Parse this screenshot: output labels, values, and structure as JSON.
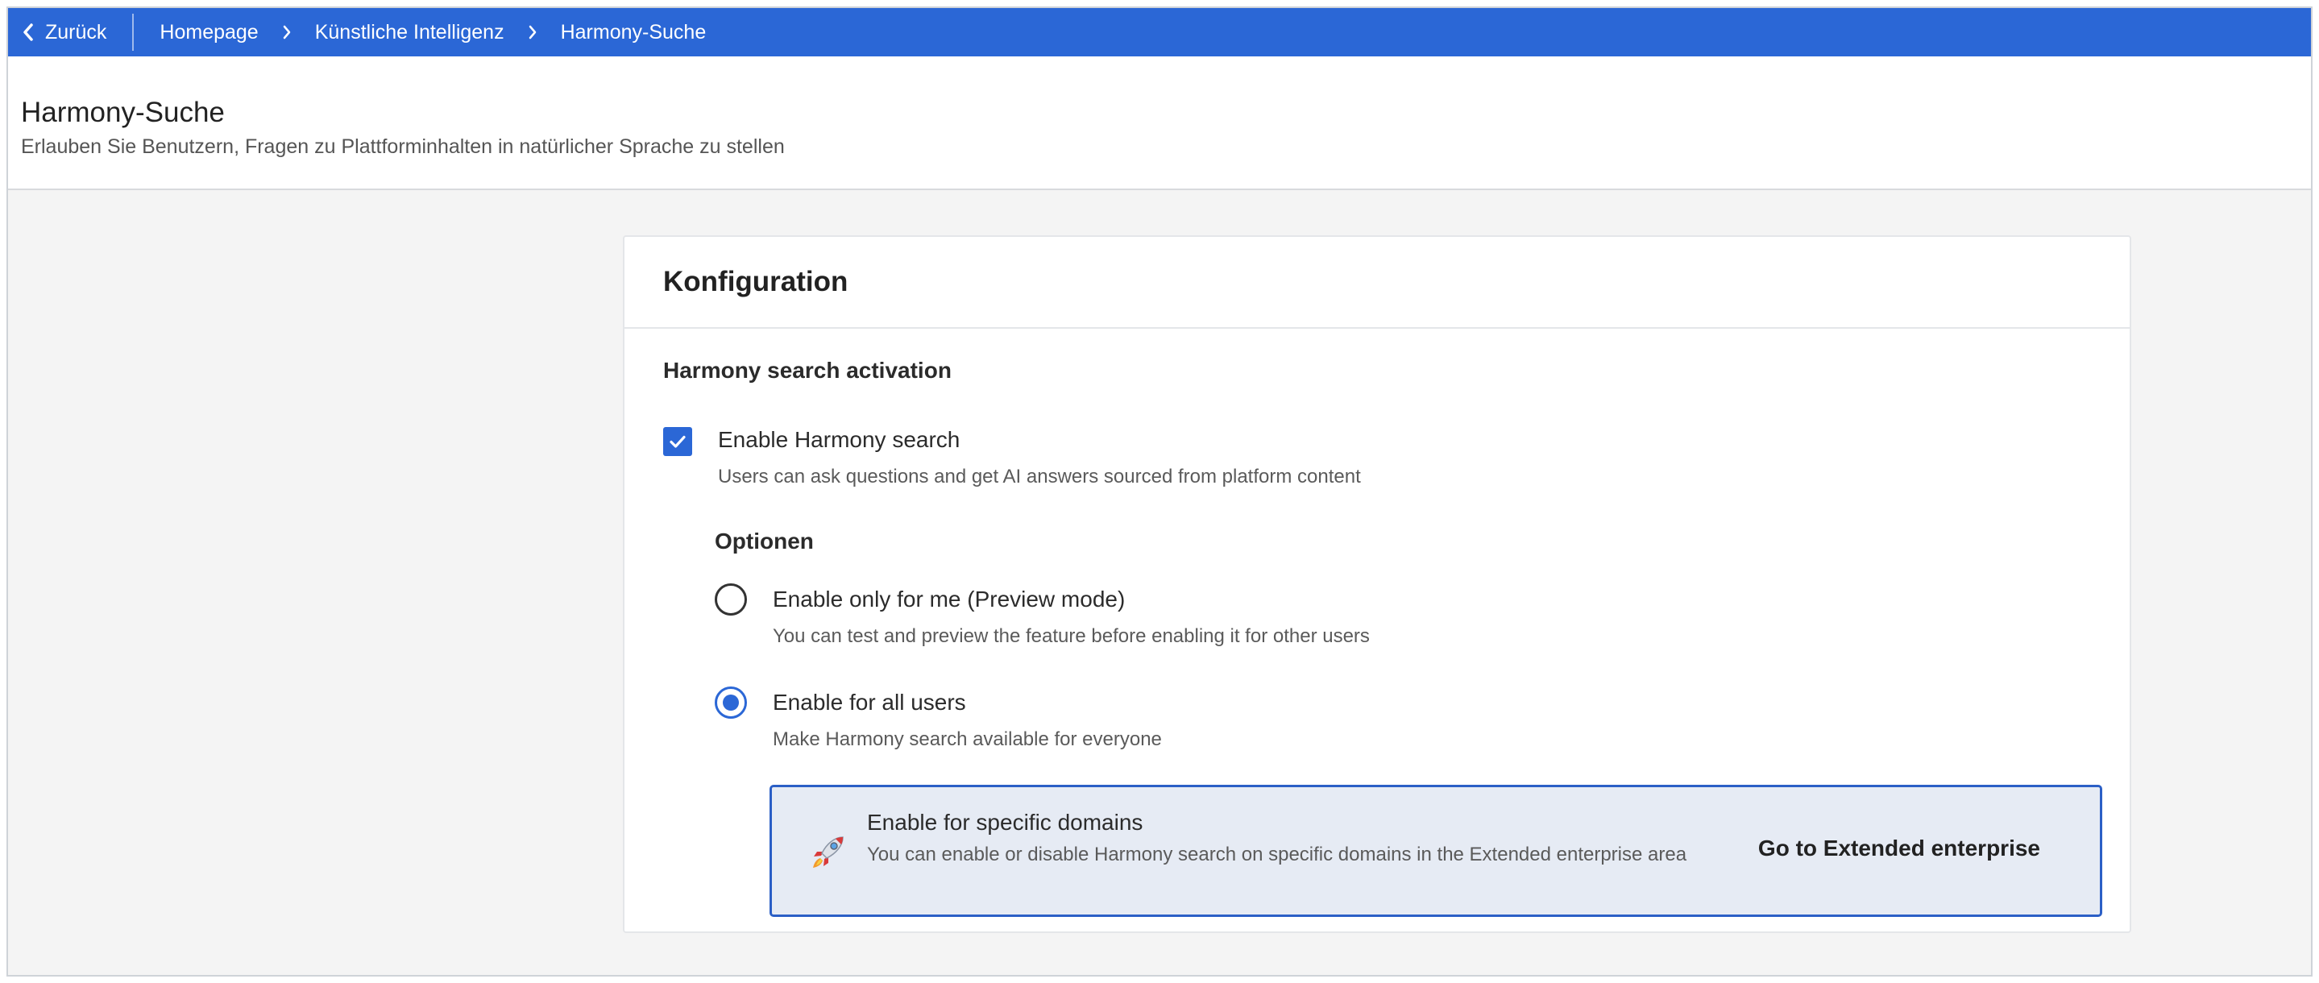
{
  "topbar": {
    "back_label": "Zurück",
    "breadcrumbs": [
      "Homepage",
      "Künstliche Intelligenz",
      "Harmony-Suche"
    ]
  },
  "header": {
    "title": "Harmony-Suche",
    "subtitle": "Erlauben Sie Benutzern, Fragen zu Plattforminhalten in natürlicher Sprache zu stellen"
  },
  "card": {
    "title": "Konfiguration",
    "section_title": "Harmony search activation",
    "enable": {
      "label": "Enable Harmony search",
      "description": "Users can ask questions and get AI answers sourced from platform content",
      "checked": true
    },
    "options_title": "Optionen",
    "options": [
      {
        "label": "Enable only for me (Preview mode)",
        "description": "You can test and preview the feature before enabling it for other users",
        "selected": false
      },
      {
        "label": "Enable for all users",
        "description": "Make Harmony search available for everyone",
        "selected": true
      }
    ],
    "domains": {
      "icon": "rocket-icon",
      "title": "Enable for specific domains",
      "description": "You can enable or disable Harmony search on specific domains in the Extended enterprise area",
      "link_label": "Go to Extended enterprise"
    }
  },
  "colors": {
    "accent": "#2b67d6",
    "box_background": "#e6ebf4",
    "page_background": "#f4f4f4"
  }
}
